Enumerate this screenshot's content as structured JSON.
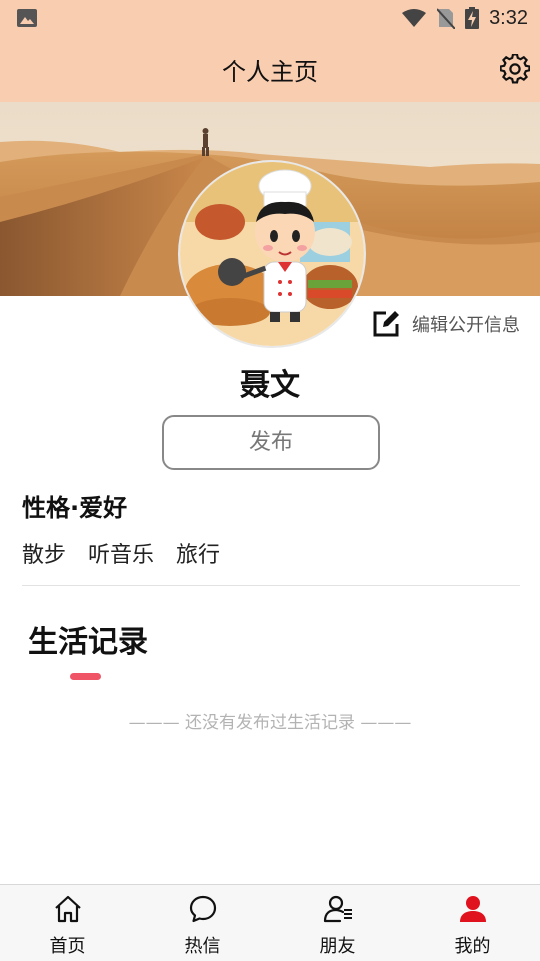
{
  "status_bar": {
    "time": "3:32"
  },
  "header": {
    "title": "个人主页"
  },
  "profile": {
    "name": "聂文",
    "edit_label": "编辑公开信息",
    "publish_label": "发布"
  },
  "personality": {
    "title": "性格·爱好",
    "hobbies": [
      "散步",
      "听音乐",
      "旅行"
    ]
  },
  "life": {
    "title": "生活记录",
    "empty_text": "——— 还没有发布过生活记录 ———"
  },
  "tabbar": {
    "items": [
      {
        "label": "首页",
        "icon": "home-icon"
      },
      {
        "label": "热信",
        "icon": "chat-bubble-icon"
      },
      {
        "label": "朋友",
        "icon": "friends-icon"
      },
      {
        "label": "我的",
        "icon": "person-icon"
      }
    ],
    "active_index": 3
  },
  "colors": {
    "header_bg": "#f9cdb0",
    "accent": "#ef5467",
    "active_icon": "#e0121d"
  }
}
